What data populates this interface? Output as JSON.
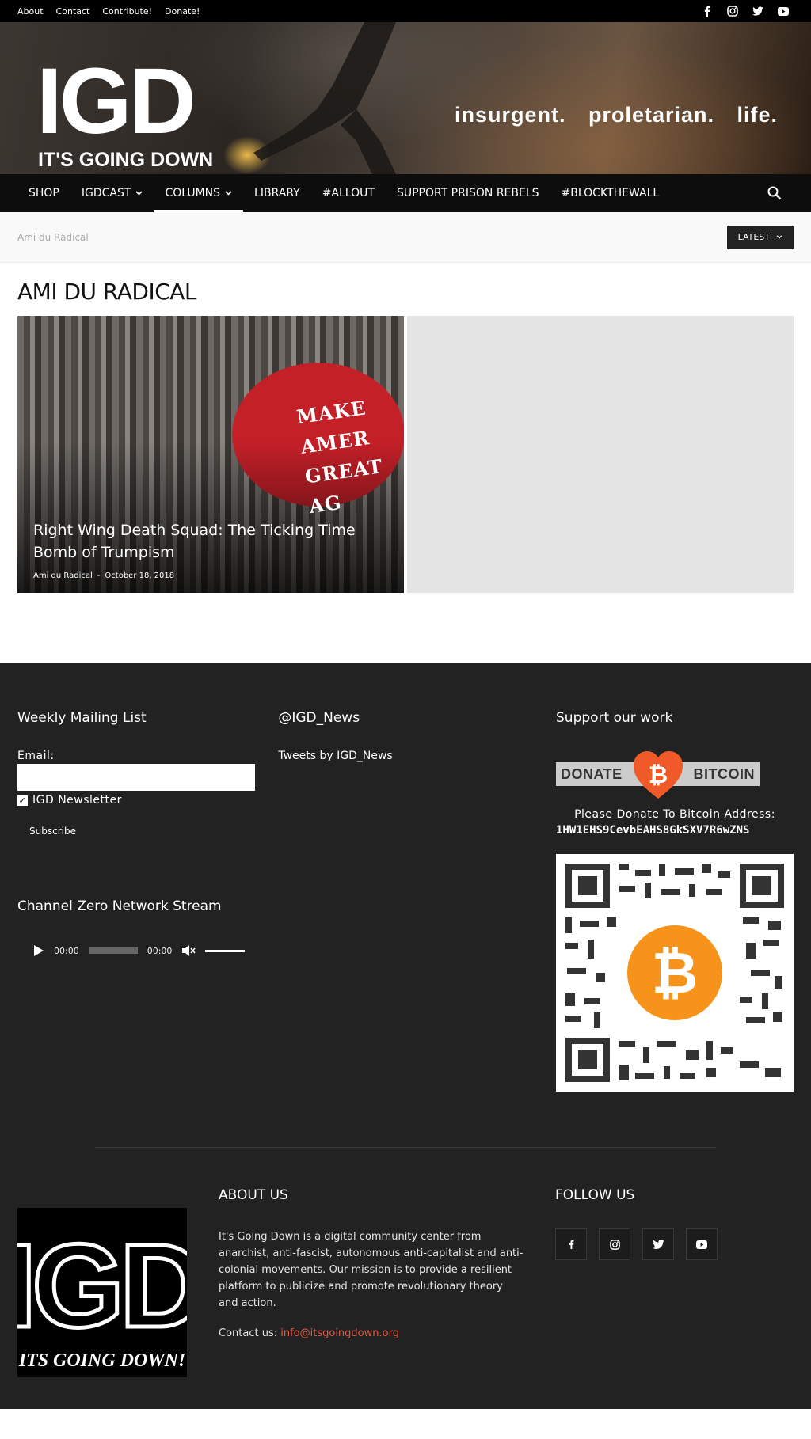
{
  "topbar": {
    "links": [
      "About",
      "Contact",
      "Contribute!",
      "Donate!"
    ],
    "social_icons": [
      "facebook-icon",
      "instagram-icon",
      "twitter-icon",
      "youtube-icon"
    ]
  },
  "header": {
    "logo": "IGD",
    "logo_sub": "IT'S GOING DOWN",
    "tagline": "insurgent. proletarian. life."
  },
  "nav": {
    "items": [
      {
        "label": "SHOP",
        "dropdown": false
      },
      {
        "label": "IGDCAST",
        "dropdown": true
      },
      {
        "label": "COLUMNS",
        "dropdown": true,
        "active": true
      },
      {
        "label": "LIBRARY",
        "dropdown": false
      },
      {
        "label": "#ALLOUT",
        "dropdown": false
      },
      {
        "label": "SUPPORT PRISON REBELS",
        "dropdown": false
      },
      {
        "label": "#BLOCKTHEWALL",
        "dropdown": false
      }
    ]
  },
  "breadcrumb": {
    "current": "Ami du Radical"
  },
  "sort": {
    "label": "LATEST"
  },
  "page": {
    "title": "AMI DU RADICAL"
  },
  "featured": {
    "hat_text": [
      "MAKE AMER",
      "GREAT AG"
    ],
    "title": "Right Wing Death Squad: The Ticking Time Bomb of Trumpism",
    "author": "Ami du Radical",
    "separator": "-",
    "date": "October 18, 2018"
  },
  "footer": {
    "mailing": {
      "title": "Weekly Mailing List",
      "email_label": "Email:",
      "email_value": "",
      "checkbox_label": "IGD Newsletter",
      "checked": true,
      "subscribe": "Subscribe"
    },
    "stream": {
      "title": "Channel Zero Network Stream",
      "time_current": "00:00",
      "time_total": "00:00"
    },
    "twitter": {
      "title": "@IGD_News",
      "tweets_link": "Tweets by IGD_News"
    },
    "support": {
      "title": "Support our work",
      "donate_left": "DONATE",
      "donate_right": "BITCOIN",
      "donate_text": "Please Donate To Bitcoin Address:",
      "address": "1HW1EHS9CevbEAHS8GkSXV7R6wZNS"
    },
    "about": {
      "title": "ABOUT US",
      "text": "It's Going Down is a digital community center from anarchist, anti-fascist, autonomous anti-capitalist and anti-colonial movements. Our mission is to provide a resilient platform to publicize and promote revolutionary theory and action.",
      "contact_label": "Contact us:",
      "contact_email": "info@itsgoingdown.org"
    },
    "logo": {
      "main": "IGD",
      "sub": "ITS GOING DOWN!"
    },
    "follow": {
      "title": "FOLLOW US",
      "icons": [
        "facebook-icon",
        "instagram-icon",
        "twitter-icon",
        "youtube-icon"
      ]
    }
  },
  "colors": {
    "topbar_bg": "#000000",
    "nav_bg": "#0d0d0d",
    "footer_bg": "#222222",
    "link_accent": "#e05a47",
    "bitcoin_orange": "#f7931a"
  }
}
